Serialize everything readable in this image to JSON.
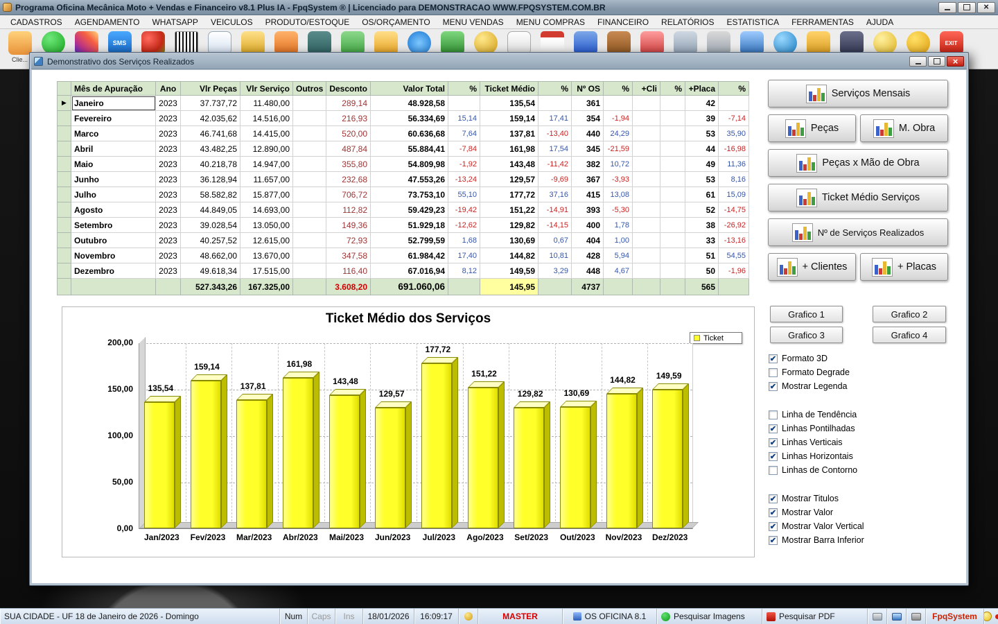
{
  "window": {
    "title": "Programa Oficina Mecânica Moto + Vendas e Financeiro v8.1 Plus IA - FpqSystem ® | Licenciado para  DEMONSTRACAO WWW.FPQSYSTEM.COM.BR"
  },
  "menu": {
    "items": [
      "CADASTROS",
      "AGENDAMENTO",
      "WHATSAPP",
      "VEICULOS",
      "PRODUTO/ESTOQUE",
      "OS/ORÇAMENTO",
      "MENU VENDAS",
      "MENU COMPRAS",
      "FINANCEIRO",
      "RELATÓRIOS",
      "ESTATISTICA",
      "FERRAMENTAS",
      "AJUDA"
    ]
  },
  "toolbar": {
    "partial_label": "Clie...",
    "icons": [
      "customer",
      "whatsapp",
      "instagram",
      "sms",
      "fruits",
      "barcode",
      "stats",
      "clipboard",
      "notes",
      "calculator",
      "ruler",
      "tasks",
      "sync",
      "cash",
      "dollar",
      "chart",
      "calendar",
      "badge",
      "wallet",
      "schedule",
      "bank",
      "printer",
      "screen",
      "globe",
      "tools",
      "phone",
      "coin",
      "alert",
      "exit"
    ],
    "sms_text": "SMS",
    "exit_text": "EXIT"
  },
  "dialog": {
    "title": "Demonstrativo dos Serviços Realizados",
    "table": {
      "headers": [
        "Mês de Apuração",
        "Ano",
        "Vlr Peças",
        "Vlr Serviço",
        "Outros",
        "Desconto",
        "Valor Total",
        "%",
        "Ticket Médio",
        "%",
        "Nº OS",
        "%",
        "+Cli",
        "%",
        "+Placa",
        "%"
      ],
      "rows": [
        [
          "Janeiro",
          "2023",
          "37.737,72",
          "11.480,00",
          "",
          "289,14",
          "48.928,58",
          "",
          "135,54",
          "",
          "361",
          "",
          "",
          "",
          "42",
          ""
        ],
        [
          "Fevereiro",
          "2023",
          "42.035,62",
          "14.516,00",
          "",
          "216,93",
          "56.334,69",
          "15,14",
          "159,14",
          "17,41",
          "354",
          "-1,94",
          "",
          "",
          "39",
          "-7,14"
        ],
        [
          "Marco",
          "2023",
          "46.741,68",
          "14.415,00",
          "",
          "520,00",
          "60.636,68",
          "7,64",
          "137,81",
          "-13,40",
          "440",
          "24,29",
          "",
          "",
          "53",
          "35,90"
        ],
        [
          "Abril",
          "2023",
          "43.482,25",
          "12.890,00",
          "",
          "487,84",
          "55.884,41",
          "-7,84",
          "161,98",
          "17,54",
          "345",
          "-21,59",
          "",
          "",
          "44",
          "-16,98"
        ],
        [
          "Maio",
          "2023",
          "40.218,78",
          "14.947,00",
          "",
          "355,80",
          "54.809,98",
          "-1,92",
          "143,48",
          "-11,42",
          "382",
          "10,72",
          "",
          "",
          "49",
          "11,36"
        ],
        [
          "Junho",
          "2023",
          "36.128,94",
          "11.657,00",
          "",
          "232,68",
          "47.553,26",
          "-13,24",
          "129,57",
          "-9,69",
          "367",
          "-3,93",
          "",
          "",
          "53",
          "8,16"
        ],
        [
          "Julho",
          "2023",
          "58.582,82",
          "15.877,00",
          "",
          "706,72",
          "73.753,10",
          "55,10",
          "177,72",
          "37,16",
          "415",
          "13,08",
          "",
          "",
          "61",
          "15,09"
        ],
        [
          "Agosto",
          "2023",
          "44.849,05",
          "14.693,00",
          "",
          "112,82",
          "59.429,23",
          "-19,42",
          "151,22",
          "-14,91",
          "393",
          "-5,30",
          "",
          "",
          "52",
          "-14,75"
        ],
        [
          "Setembro",
          "2023",
          "39.028,54",
          "13.050,00",
          "",
          "149,36",
          "51.929,18",
          "-12,62",
          "129,82",
          "-14,15",
          "400",
          "1,78",
          "",
          "",
          "38",
          "-26,92"
        ],
        [
          "Outubro",
          "2023",
          "40.257,52",
          "12.615,00",
          "",
          "72,93",
          "52.799,59",
          "1,68",
          "130,69",
          "0,67",
          "404",
          "1,00",
          "",
          "",
          "33",
          "-13,16"
        ],
        [
          "Novembro",
          "2023",
          "48.662,00",
          "13.670,00",
          "",
          "347,58",
          "61.984,42",
          "17,40",
          "144,82",
          "10,81",
          "428",
          "5,94",
          "",
          "",
          "51",
          "54,55"
        ],
        [
          "Dezembro",
          "2023",
          "49.618,34",
          "17.515,00",
          "",
          "116,40",
          "67.016,94",
          "8,12",
          "149,59",
          "3,29",
          "448",
          "4,67",
          "",
          "",
          "50",
          "-1,96"
        ]
      ],
      "totals": [
        "",
        "",
        "527.343,26",
        "167.325,00",
        "",
        "3.608,20",
        "691.060,06",
        "",
        "145,95",
        "",
        "4737",
        "",
        "",
        "",
        "565",
        ""
      ]
    },
    "buttons": {
      "servicos_mensais": "Serviços Mensais",
      "pecas": "Peças",
      "m_obra": "M. Obra",
      "pecas_mao_obra": "Peças x Mão de Obra",
      "ticket_medio": "Ticket Médio Serviços",
      "num_servicos": "Nº de Serviços Realizados",
      "clientes": "+ Clientes",
      "placas": "+ Placas",
      "grafico1": "Grafico 1",
      "grafico2": "Grafico 2",
      "grafico3": "Grafico 3",
      "grafico4": "Grafico 4"
    },
    "checkbox_groups": [
      {
        "items": [
          {
            "label": "Formato 3D",
            "checked": true
          },
          {
            "label": "Formato Degrade",
            "checked": false
          },
          {
            "label": "Mostrar Legenda",
            "checked": true
          }
        ]
      },
      {
        "items": [
          {
            "label": "Linha de Tendência",
            "checked": false
          },
          {
            "label": "Linhas Pontilhadas",
            "checked": true
          },
          {
            "label": "Linhas Verticais",
            "checked": true
          },
          {
            "label": "Linhas Horizontais",
            "checked": true
          },
          {
            "label": "Linhas de Contorno",
            "checked": false
          }
        ]
      },
      {
        "items": [
          {
            "label": "Mostrar Titulos",
            "checked": true
          },
          {
            "label": "Mostrar Valor",
            "checked": true
          },
          {
            "label": "Mostrar Valor Vertical",
            "checked": true
          },
          {
            "label": "Mostrar Barra Inferior",
            "checked": true
          }
        ]
      }
    ]
  },
  "chart_data": {
    "type": "bar",
    "title": "Ticket Médio dos Serviços",
    "legend": [
      "Ticket"
    ],
    "legend_position": "top-right",
    "categories": [
      "Jan/2023",
      "Fev/2023",
      "Mar/2023",
      "Abr/2023",
      "Mai/2023",
      "Jun/2023",
      "Jul/2023",
      "Ago/2023",
      "Set/2023",
      "Out/2023",
      "Nov/2023",
      "Dez/2023"
    ],
    "values": [
      135.54,
      159.14,
      137.81,
      161.98,
      143.48,
      129.57,
      177.72,
      151.22,
      129.82,
      130.69,
      144.82,
      149.59
    ],
    "value_labels": [
      "135,54",
      "159,14",
      "137,81",
      "161,98",
      "143,48",
      "129,57",
      "177,72",
      "151,22",
      "129,82",
      "130,69",
      "144,82",
      "149,59"
    ],
    "xlabel": "",
    "ylabel": "",
    "ylim": [
      0,
      200
    ],
    "yticks": [
      "0,00",
      "50,00",
      "100,00",
      "150,00",
      "200,00"
    ],
    "grid": true,
    "style": "3d",
    "bar_color": "#ffff33"
  },
  "status_bar": {
    "location": "SUA CIDADE - UF 18 de Janeiro de 2026 - Domingo",
    "num": "Num",
    "caps": "Caps",
    "ins": "Ins",
    "date": "18/01/2026",
    "time": "16:09:17",
    "user": "MASTER",
    "system": "OS OFICINA 8.1",
    "search_images": "Pesquisar Imagens",
    "search_pdf": "Pesquisar PDF",
    "brand": "FpqSystem"
  }
}
